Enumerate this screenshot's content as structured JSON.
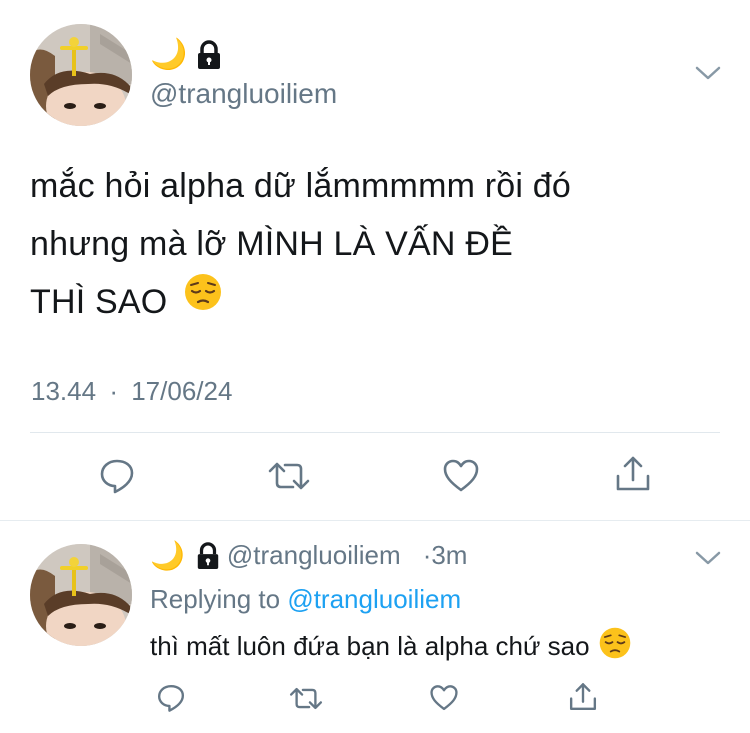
{
  "main_tweet": {
    "moon_emoji": "🌙",
    "handle": "@trangluoiliem",
    "text_lines": [
      "mắc hỏi alpha dữ lắmmmmm rồi đó",
      "nhưng mà lỡ MÌNH LÀ VẤN ĐỀ",
      "THÌ SAO"
    ],
    "time": "13.44",
    "separator": "·",
    "date": "17/06/24"
  },
  "reply_tweet": {
    "moon_emoji": "🌙",
    "handle": "@trangluoiliem",
    "age": "·3m",
    "replying_prefix": "Replying to",
    "replying_handle": "@trangluoiliem",
    "text": "thì mất luôn đứa bạn là alpha chứ sao"
  },
  "icons": {
    "lock": "lock-icon",
    "chevron": "chevron-down-icon",
    "reply": "reply-icon",
    "retweet": "retweet-icon",
    "like": "heart-icon",
    "share": "share-icon",
    "emoji": "pensive-face-emoji"
  },
  "colors": {
    "text": "#14171a",
    "secondary": "#657786",
    "link": "#1da1f2",
    "divider": "#e1e8ed"
  }
}
